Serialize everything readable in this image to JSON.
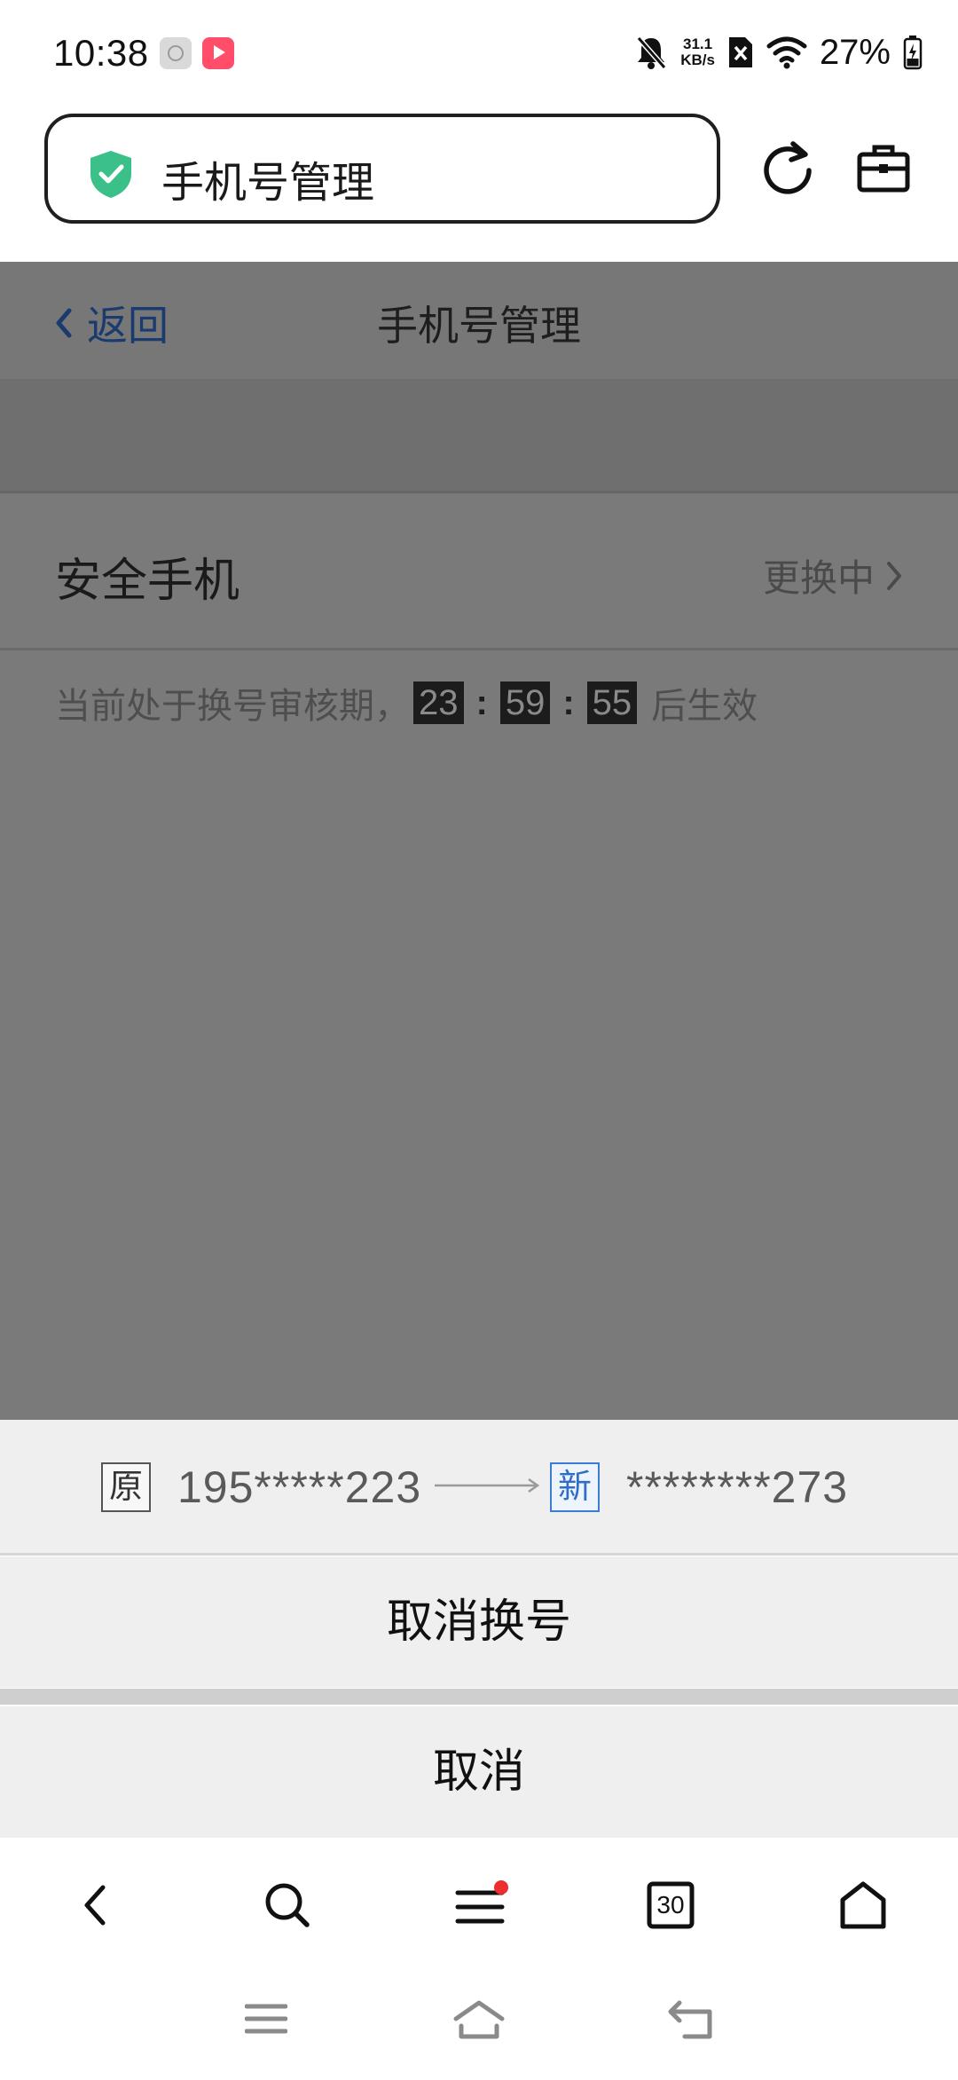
{
  "status_bar": {
    "time": "10:38",
    "net_speed_value": "31.1",
    "net_speed_unit": "KB/s",
    "battery": "27%",
    "icons": [
      "settings-app-icon",
      "video-app-icon",
      "mute-icon",
      "no-sim-icon",
      "wifi-icon",
      "battery-icon"
    ]
  },
  "address_bar": {
    "text": "手机号管理",
    "security": "shield-check-icon",
    "accent": "#3cc08a"
  },
  "page": {
    "back_label": "返回",
    "title": "手机号管理",
    "phone_row_label": "安全手机",
    "phone_row_status": "更换中",
    "notice_prefix": "当前处于换号审核期，",
    "countdown": {
      "hours": "23",
      "minutes": "59",
      "seconds": "55",
      "separator": ":"
    },
    "notice_suffix": "后生效"
  },
  "action_sheet": {
    "original_tag": "原",
    "original_number": "195*****223",
    "new_tag": "新",
    "new_number": "********273",
    "cancel_change_label": "取消换号",
    "cancel_label": "取消"
  },
  "browser_toolbar": {
    "tabs_count": "30",
    "items": [
      "back-icon",
      "search-icon",
      "menu-icon",
      "tabs-icon",
      "home-icon"
    ]
  },
  "colors": {
    "link_blue": "#1b3b6f",
    "new_tag_blue": "#2f6ec8",
    "badge_red": "#ee2d2d",
    "overlay": "#7a7a7a"
  }
}
